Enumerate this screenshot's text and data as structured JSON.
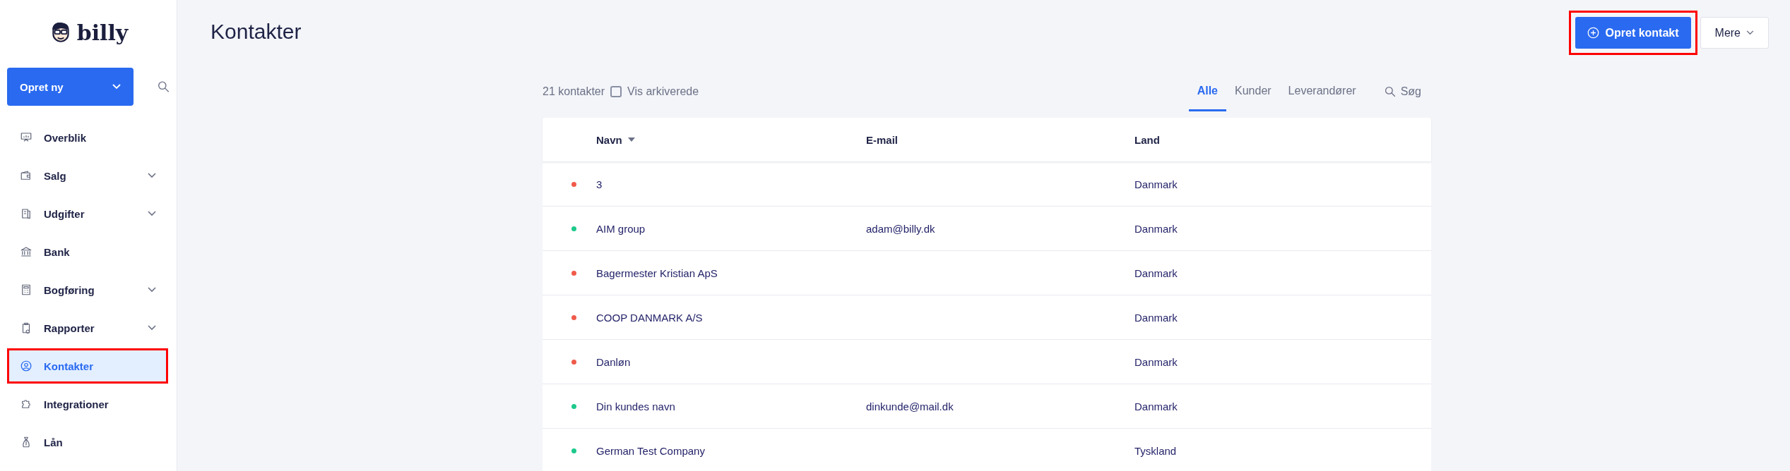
{
  "sidebar": {
    "logo": "billy",
    "create_button": "Opret ny",
    "items": [
      {
        "label": "Overblik",
        "expandable": false,
        "selected": false,
        "highlighted": false
      },
      {
        "label": "Salg",
        "expandable": true,
        "selected": false,
        "highlighted": false
      },
      {
        "label": "Udgifter",
        "expandable": true,
        "selected": false,
        "highlighted": false
      },
      {
        "label": "Bank",
        "expandable": false,
        "selected": false,
        "highlighted": false
      },
      {
        "label": "Bogføring",
        "expandable": true,
        "selected": false,
        "highlighted": false
      },
      {
        "label": "Rapporter",
        "expandable": true,
        "selected": false,
        "highlighted": false
      },
      {
        "label": "Kontakter",
        "expandable": false,
        "selected": true,
        "highlighted": true
      },
      {
        "label": "Integrationer",
        "expandable": false,
        "selected": false,
        "highlighted": false
      },
      {
        "label": "Lån",
        "expandable": false,
        "selected": false,
        "highlighted": false
      }
    ]
  },
  "header": {
    "title": "Kontakter",
    "primary_button": {
      "label": "Opret kontakt",
      "highlighted": true
    },
    "more_button": "Mere"
  },
  "toolbar": {
    "count": "21 kontakter",
    "show_archived": {
      "label": "Vis arkiverede",
      "checked": false
    },
    "tabs": [
      {
        "label": "Alle",
        "selected": true
      },
      {
        "label": "Kunder",
        "selected": false
      },
      {
        "label": "Leverandører",
        "selected": false
      }
    ],
    "search": "Søg"
  },
  "table": {
    "columns": [
      "Navn",
      "E-mail",
      "Land"
    ],
    "rows": [
      {
        "color": "#f05a4a",
        "name": "3",
        "email": "",
        "country": "Danmark"
      },
      {
        "color": "#1dc98b",
        "name": "AIM group",
        "email": "adam@billy.dk",
        "country": "Danmark"
      },
      {
        "color": "#f05a4a",
        "name": "Bagermester Kristian ApS",
        "email": "",
        "country": "Danmark"
      },
      {
        "color": "#f05a4a",
        "name": "COOP DANMARK A/S",
        "email": "",
        "country": "Danmark"
      },
      {
        "color": "#f05a4a",
        "name": "Danløn",
        "email": "",
        "country": "Danmark"
      },
      {
        "color": "#1dc98b",
        "name": "Din kundes navn",
        "email": "dinkunde@mail.dk",
        "country": "Danmark"
      },
      {
        "color": "#1dc98b",
        "name": "German Test Company",
        "email": "",
        "country": "Tyskland"
      }
    ]
  }
}
